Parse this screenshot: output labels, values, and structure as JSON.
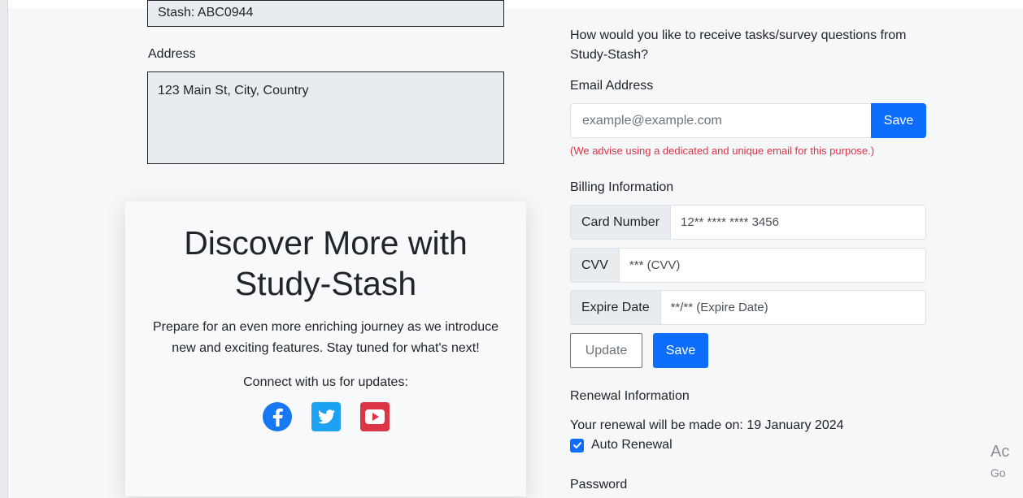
{
  "profile": {
    "stash_value": "Stash: ABC0944",
    "address_label": "Address",
    "address_value": "123 Main St, City, Country"
  },
  "promo": {
    "title_line1": "Discover More with",
    "title_line2": "Study-Stash",
    "text": "Prepare for an even more enriching journey as we introduce new and exciting features. Stay tuned for what's next!",
    "connect": "Connect with us for updates:",
    "social_icons": [
      "facebook-icon",
      "twitter-icon",
      "youtube-icon"
    ]
  },
  "contact": {
    "question": "How would you like to receive tasks/survey questions from Study-Stash?",
    "email_label": "Email Address",
    "email_placeholder": "example@example.com",
    "email_save": "Save",
    "advice": "(We advise using a dedicated and unique email for this purpose.)"
  },
  "billing": {
    "heading": "Billing Information",
    "card_label": "Card Number",
    "card_value": "12** **** **** 3456",
    "cvv_label": "CVV",
    "cvv_value": "*** (CVV)",
    "expire_label": "Expire Date",
    "expire_value": "**/** (Expire Date)",
    "update_button": "Update",
    "save_button": "Save"
  },
  "renewal": {
    "heading": "Renewal Information",
    "text": "Your renewal will be made on: 19 January 2024",
    "auto_label": "Auto Renewal",
    "auto_checked": true
  },
  "password": {
    "label": "Password"
  },
  "watermark": {
    "line1": "Ac",
    "line2": "Go"
  },
  "colors": {
    "primary": "#0d6efd",
    "danger": "#dc3545",
    "facebook": "#1877f2",
    "twitter": "#1da1f2",
    "youtube": "#dc3545"
  }
}
